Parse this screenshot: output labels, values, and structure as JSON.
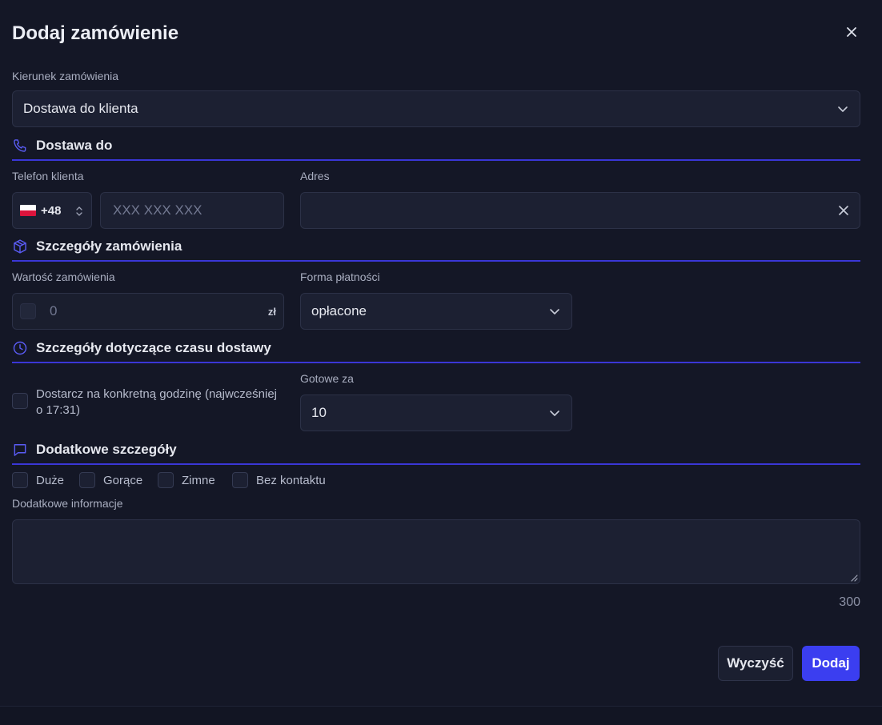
{
  "dialog": {
    "title": "Dodaj zamówienie",
    "close_icon": "close-icon"
  },
  "direction": {
    "label": "Kierunek zamówienia",
    "value": "Dostawa do klienta"
  },
  "sections": {
    "delivery": {
      "title": "Dostawa do",
      "icon": "phone-icon"
    },
    "order_details": {
      "title": "Szczegóły zamówienia",
      "icon": "package-icon"
    },
    "time_details": {
      "title": "Szczegóły dotyczące czasu dostawy",
      "icon": "clock-icon"
    },
    "extra_details": {
      "title": "Dodatkowe szczegóły",
      "icon": "message-icon"
    }
  },
  "phone": {
    "label": "Telefon klienta",
    "country_code": "+48",
    "flag": "PL",
    "placeholder": "XXX XXX XXX"
  },
  "address": {
    "label": "Adres",
    "value": ""
  },
  "order_value": {
    "label": "Wartość zamówienia",
    "value": "0",
    "currency": "zł"
  },
  "payment": {
    "label": "Forma płatności",
    "value": "opłacone"
  },
  "specific_time": {
    "label": "Dostarcz na konkretną godzinę (najwcześniej o 17:31)"
  },
  "ready_in": {
    "label": "Gotowe za",
    "value": "10"
  },
  "flags": [
    {
      "label": "Duże"
    },
    {
      "label": "Gorące"
    },
    {
      "label": "Zimne"
    },
    {
      "label": "Bez kontaktu"
    }
  ],
  "extra_info": {
    "label": "Dodatkowe informacje",
    "value": "",
    "char_counter": "300"
  },
  "buttons": {
    "clear": "Wyczyść",
    "add": "Dodaj"
  },
  "colors": {
    "accent": "#3b3ef0",
    "section_rule": "#3a36d6",
    "background": "#141726",
    "field": "#1c2032"
  }
}
